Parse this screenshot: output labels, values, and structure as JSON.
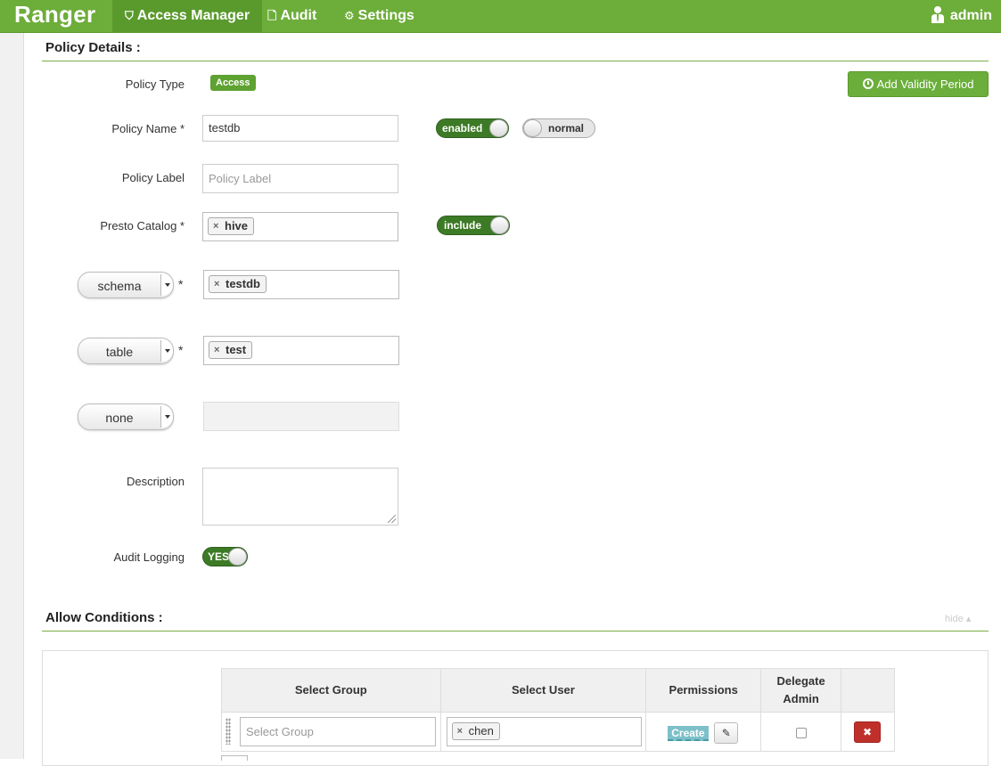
{
  "navbar": {
    "brand": "Ranger",
    "items": [
      {
        "label": "Access Manager",
        "icon": "shield-icon",
        "active": true
      },
      {
        "label": "Audit",
        "icon": "file-icon",
        "active": false
      },
      {
        "label": "Settings",
        "icon": "gear-icon",
        "active": false
      }
    ],
    "user": "admin",
    "accent": "#6dad3a"
  },
  "policy_details": {
    "title": "Policy Details :",
    "policy_type_label": "Policy Type",
    "policy_type_value": "Access",
    "add_validity_label": "Add Validity Period",
    "policy_name_label": "Policy Name *",
    "policy_name_value": "testdb",
    "enabled_toggle": "enabled",
    "normal_toggle": "normal",
    "policy_label_label": "Policy Label",
    "policy_label_placeholder": "Policy Label",
    "catalog_label": "Presto Catalog *",
    "catalog_tag": "hive",
    "include_toggle": "include",
    "schema_select": "schema",
    "schema_tag": "testdb",
    "table_select": "table",
    "table_tag": "test",
    "column_select": "none",
    "required_mark": "*",
    "description_label": "Description",
    "audit_label": "Audit Logging",
    "audit_toggle": "YES"
  },
  "allow_conditions": {
    "title": "Allow Conditions :",
    "hide_label": "hide ▴",
    "columns": {
      "group": "Select Group",
      "user": "Select User",
      "permissions": "Permissions",
      "delegate_line1": "Delegate",
      "delegate_line2": "Admin"
    },
    "row": {
      "group_placeholder": "Select Group",
      "user_tag": "chen",
      "permission": "Create",
      "edit_icon": "✎",
      "delete_icon": "✖"
    }
  }
}
